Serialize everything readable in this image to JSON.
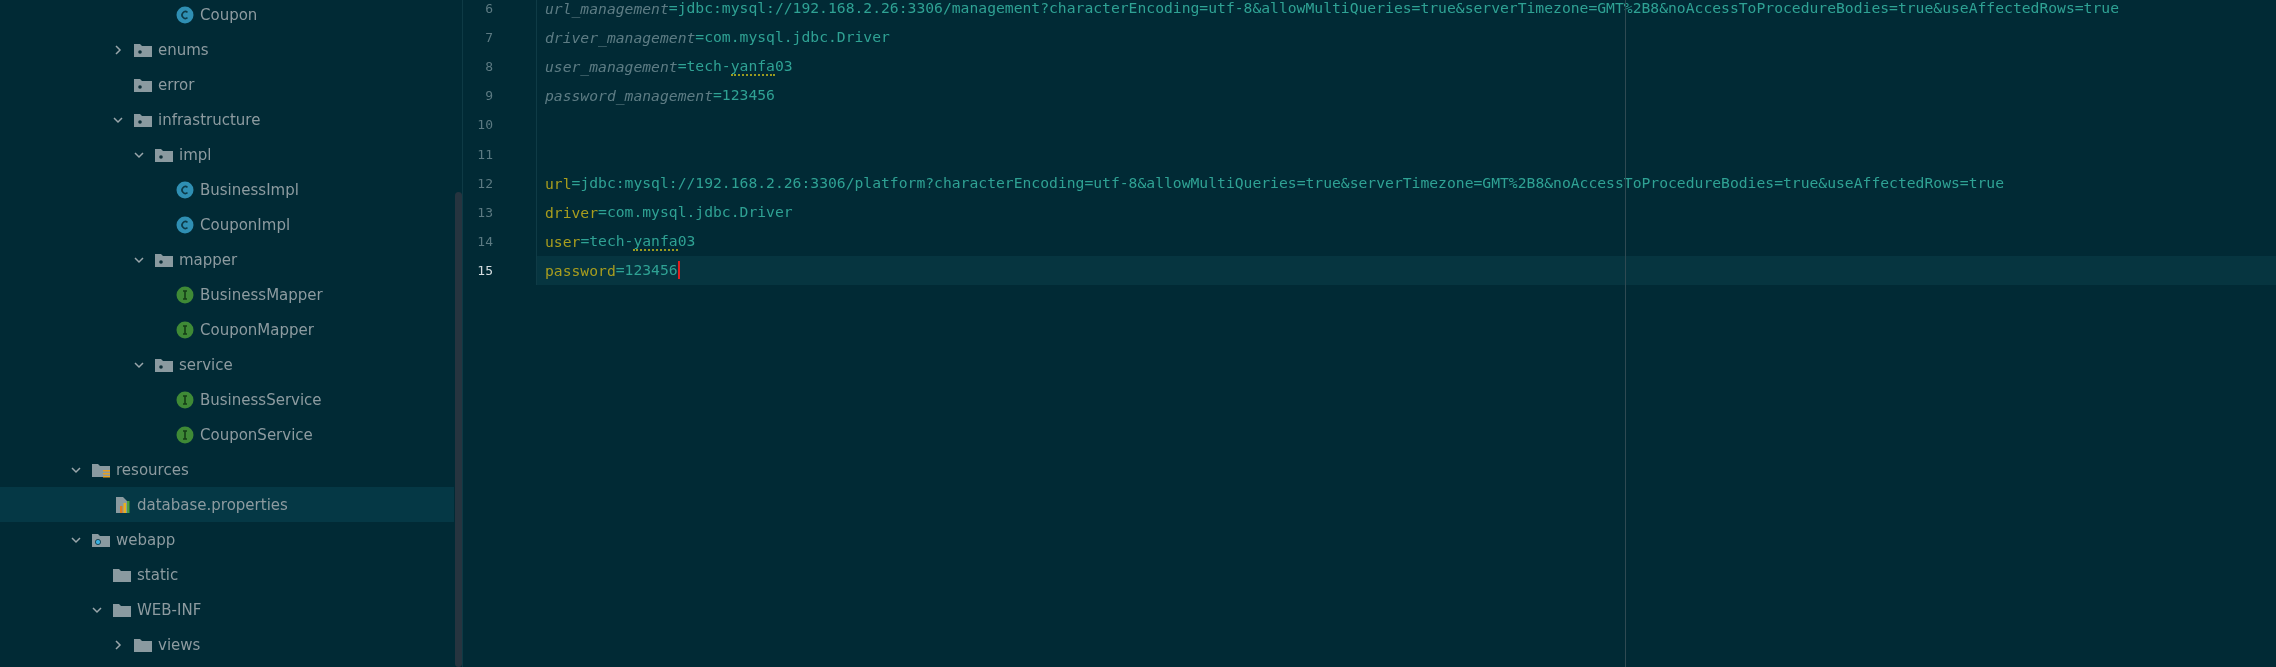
{
  "project_tree": [
    {
      "children": [
        {
          "children": [
            {
              "children": [
                {
                  "children": [
                    {
                      "label": "Coupon",
                      "kind": "class",
                      "selected": false
                    }
                  ]
                }
              ]
            },
            {
              "label": "enums",
              "kind": "package",
              "expanded": false,
              "selected": false
            },
            {
              "label": "error",
              "kind": "package",
              "selected": false
            },
            {
              "label": "infrastructure",
              "kind": "package",
              "expanded": true,
              "selected": false,
              "children": [
                {
                  "label": "impl",
                  "kind": "package",
                  "expanded": true,
                  "selected": false,
                  "children": [
                    {
                      "label": "BusinessImpl",
                      "kind": "class",
                      "selected": false
                    },
                    {
                      "label": "CouponImpl",
                      "kind": "class",
                      "selected": false
                    }
                  ]
                },
                {
                  "label": "mapper",
                  "kind": "package",
                  "expanded": true,
                  "selected": false,
                  "children": [
                    {
                      "label": "BusinessMapper",
                      "kind": "interface",
                      "selected": false
                    },
                    {
                      "label": "CouponMapper",
                      "kind": "interface",
                      "selected": false
                    }
                  ]
                },
                {
                  "label": "service",
                  "kind": "package",
                  "expanded": true,
                  "selected": false,
                  "children": [
                    {
                      "label": "BusinessService",
                      "kind": "interface",
                      "selected": false
                    },
                    {
                      "label": "CouponService",
                      "kind": "interface",
                      "selected": false
                    }
                  ]
                }
              ]
            }
          ]
        }
      ]
    },
    {
      "label": "resources",
      "kind": "resources",
      "expanded": true,
      "selected": false,
      "children": [
        {
          "label": "database.properties",
          "kind": "properties",
          "selected": true
        }
      ]
    },
    {
      "label": "webapp",
      "kind": "webroot",
      "expanded": true,
      "selected": false,
      "children": [
        {
          "label": "static",
          "kind": "folder",
          "selected": false
        },
        {
          "label": "WEB-INF",
          "kind": "folder",
          "expanded": true,
          "selected": false,
          "children": [
            {
              "label": "views",
              "kind": "folder",
              "expanded": false,
              "selected": false
            }
          ]
        }
      ]
    }
  ],
  "editor": {
    "lines": [
      {
        "number": "6",
        "key": "url_management",
        "separator": "=",
        "unused": true,
        "current": false,
        "value": [
          {
            "text": "jdbc:mysql://192.168.2.26:3306/management?characterEncoding=utf-8&allowMultiQueries=true&serverTimezone=GMT%2B8&noAccessToProcedureBodies=true&useAffectedRows=true",
            "typo": false
          }
        ]
      },
      {
        "number": "7",
        "key": "driver_management",
        "separator": "=",
        "unused": true,
        "current": false,
        "value": [
          {
            "text": "com.mysql.jdbc.Driver",
            "typo": false
          }
        ]
      },
      {
        "number": "8",
        "key": "user_management",
        "separator": "=",
        "unused": true,
        "current": false,
        "value": [
          {
            "text": "tech-",
            "typo": false
          },
          {
            "text": "yanfa",
            "typo": true
          },
          {
            "text": "03",
            "typo": false
          }
        ]
      },
      {
        "number": "9",
        "key": "password_management",
        "separator": "=",
        "unused": true,
        "current": false,
        "value": [
          {
            "text": "123456",
            "typo": false
          }
        ]
      },
      {
        "number": "10",
        "current": false
      },
      {
        "number": "11",
        "current": false
      },
      {
        "number": "12",
        "key": "url",
        "separator": "=",
        "unused": false,
        "current": false,
        "value": [
          {
            "text": "jdbc:mysql://192.168.2.26:3306/platform?characterEncoding=utf-8&allowMultiQueries=true&serverTimezone=GMT%2B8&noAccessToProcedureBodies=true&useAffectedRows=true",
            "typo": false
          }
        ]
      },
      {
        "number": "13",
        "key": "driver",
        "separator": "=",
        "unused": false,
        "current": false,
        "value": [
          {
            "text": "com.mysql.jdbc.Driver",
            "typo": false
          }
        ]
      },
      {
        "number": "14",
        "key": "user",
        "separator": "=",
        "unused": false,
        "current": false,
        "value": [
          {
            "text": "tech-",
            "typo": false
          },
          {
            "text": "yanfa",
            "typo": true
          },
          {
            "text": "03",
            "typo": false
          }
        ]
      },
      {
        "number": "15",
        "key": "password",
        "separator": "=",
        "unused": false,
        "current": true,
        "value": [
          {
            "text": "123456",
            "typo": false
          }
        ]
      }
    ]
  }
}
